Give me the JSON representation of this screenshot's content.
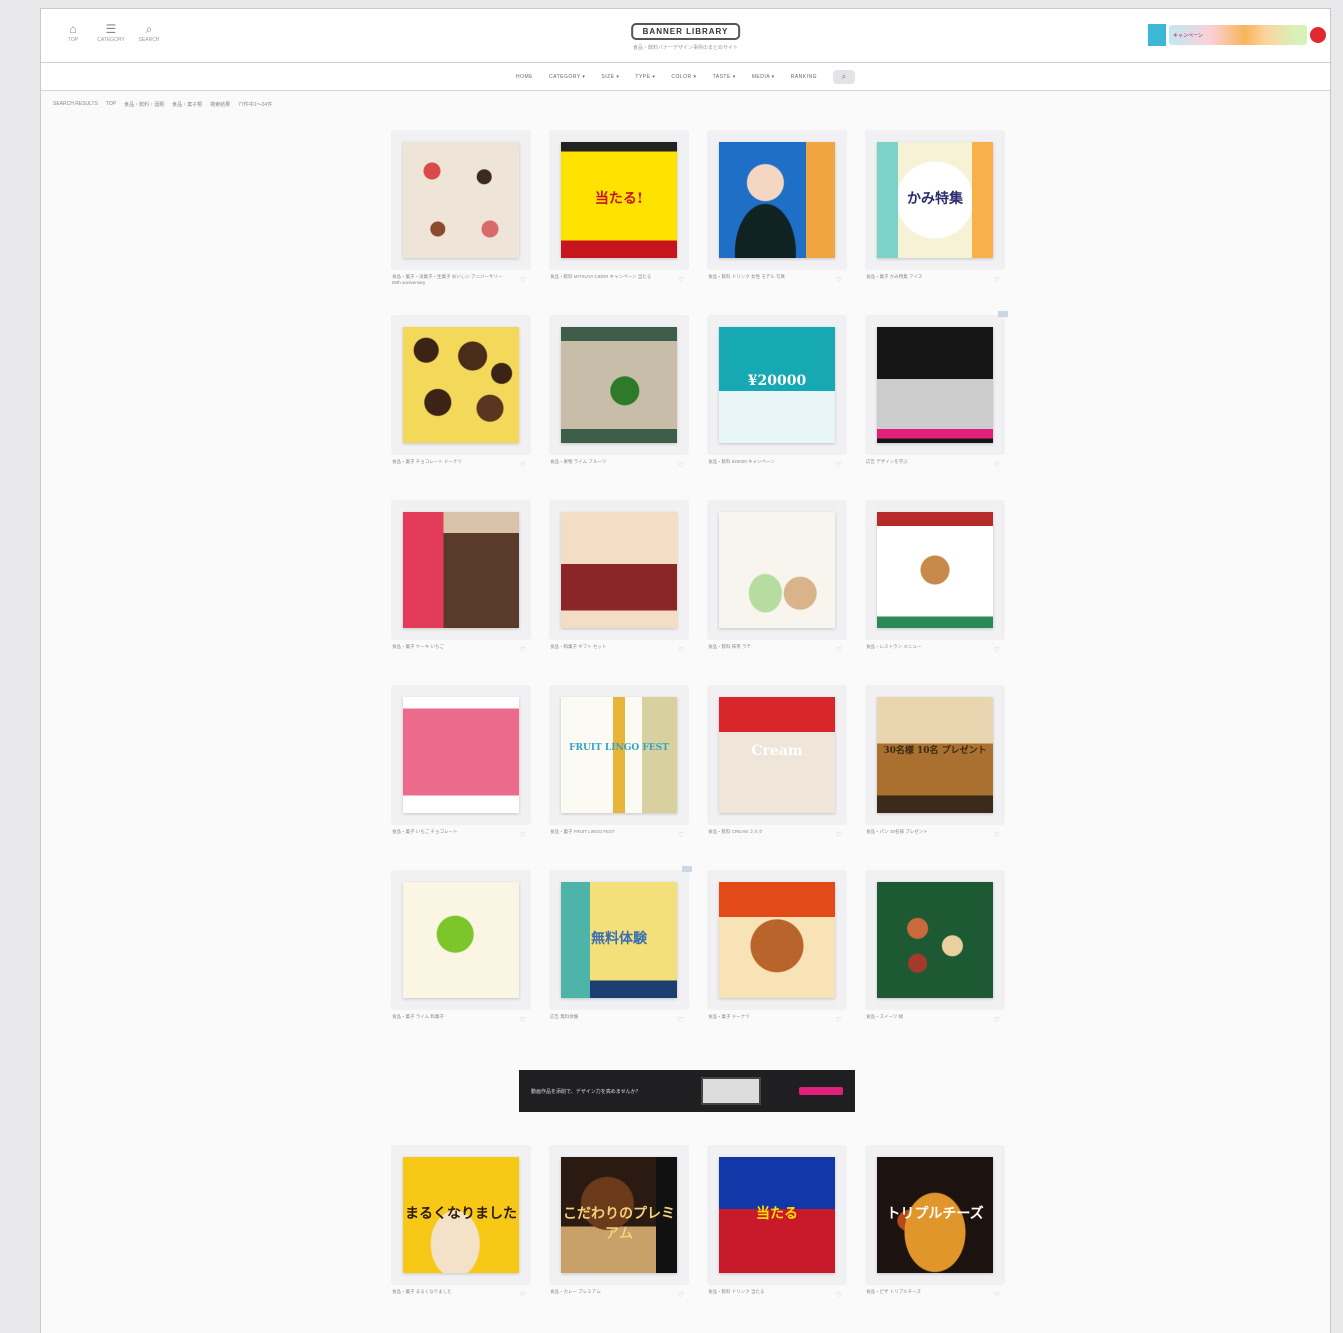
{
  "header": {
    "icons": [
      {
        "icon": "home-icon",
        "label": "TOP"
      },
      {
        "icon": "category-icon",
        "label": "CATEGORY"
      },
      {
        "icon": "search-icon",
        "label": "SEARCH"
      }
    ],
    "logo": "BANNER LIBRARY",
    "tagline": "食品・飲料バナーデザイン事例のまとめサイト",
    "banner_text": "キャンペーン"
  },
  "nav": {
    "items": [
      "HOME",
      "CATEGORY ▾",
      "SIZE ▾",
      "TYPE ▾",
      "COLOR ▾",
      "TASTE ▾",
      "MEDIA ▾",
      "RANKING"
    ],
    "search_icon": "magnifier-icon"
  },
  "breadcrumb": [
    "SEARCH RESULTS",
    "TOP",
    "食品・飲料・酒類",
    "食品・菓子類",
    "検索結果",
    "77件中1〜24件"
  ],
  "cards": [
    {
      "caption": "食品・菓子・洋菓子・生菓子 おいしい アニバーサリー 85th anniversary",
      "style": "cream",
      "title": "",
      "ad": false
    },
    {
      "caption": "食品・飲料 MITSUYA CIDER キャンペーン 当たる",
      "style": "mitsuya",
      "title": "当たる!",
      "ad": false
    },
    {
      "caption": "食品・飲料 ドリンク 女性 モデル 写真",
      "style": "blue-woman",
      "title": "",
      "ad": false
    },
    {
      "caption": "食品・菓子 かみ特集 アイス",
      "style": "kami",
      "title": "かみ特集",
      "ad": false
    },
    {
      "caption": "食品・菓子 チョコレート ドーナツ",
      "style": "donut",
      "title": "",
      "ad": false
    },
    {
      "caption": "食品・果物 ライム フルーツ",
      "style": "lime",
      "title": "",
      "ad": false
    },
    {
      "caption": "食品・飲料 ¥20000 キャンペーン",
      "style": "teal",
      "title": "¥20000",
      "ad": false
    },
    {
      "caption": "広告 デザインを学ぶ",
      "style": "dark-ad",
      "title": "",
      "ad": true
    },
    {
      "caption": "食品・菓子 ケーキ いちご",
      "style": "cake",
      "title": "",
      "ad": false
    },
    {
      "caption": "食品・和菓子 ギフト セット",
      "style": "gift",
      "title": "",
      "ad": false
    },
    {
      "caption": "食品・飲料 抹茶 ラテ",
      "style": "matcha",
      "title": "",
      "ad": false
    },
    {
      "caption": "食品・レストラン メニュー",
      "style": "menu",
      "title": "",
      "ad": false
    },
    {
      "caption": "食品・菓子 いちご チョコレート",
      "style": "strawberry",
      "title": "",
      "ad": false
    },
    {
      "caption": "食品・菓子 FRUIT LINGO FEST",
      "style": "fruit",
      "title": "FRUIT LINGO FEST",
      "ad": false
    },
    {
      "caption": "食品・飲料 CREAM ミルク",
      "style": "cream-red",
      "title": "Cream",
      "ad": false
    },
    {
      "caption": "食品・パン 30名様 プレゼント",
      "style": "bread",
      "title": "30名様 10名 プレゼント",
      "ad": false
    },
    {
      "caption": "食品・菓子 ライム 和菓子",
      "style": "green-dot",
      "title": "",
      "ad": false
    },
    {
      "caption": "広告 無料体験",
      "style": "yellow-ad",
      "title": "無料体験",
      "ad": true
    },
    {
      "caption": "食品・菓子 ドーナツ",
      "style": "donut-orange",
      "title": "",
      "ad": false
    },
    {
      "caption": "食品・スイーツ 緑",
      "style": "dark-green",
      "title": "",
      "ad": false
    }
  ],
  "mid_banner": {
    "text": "動画作品を添削で、デザイン力を高めませんか？"
  },
  "cards2": [
    {
      "caption": "食品・菓子 まるくなりました",
      "style": "yellow-chips",
      "title": "まるくなりました",
      "ad": false
    },
    {
      "caption": "食品・カレー プレミアム",
      "style": "premium",
      "title": "こだわりのプレミアム",
      "ad": false
    },
    {
      "caption": "食品・飲料 ドリンク 当たる",
      "style": "blue-drink",
      "title": "当たる",
      "ad": false
    },
    {
      "caption": "食品・ピザ トリプルチーズ",
      "style": "cheese",
      "title": "トリプルチーズ",
      "ad": false
    }
  ]
}
